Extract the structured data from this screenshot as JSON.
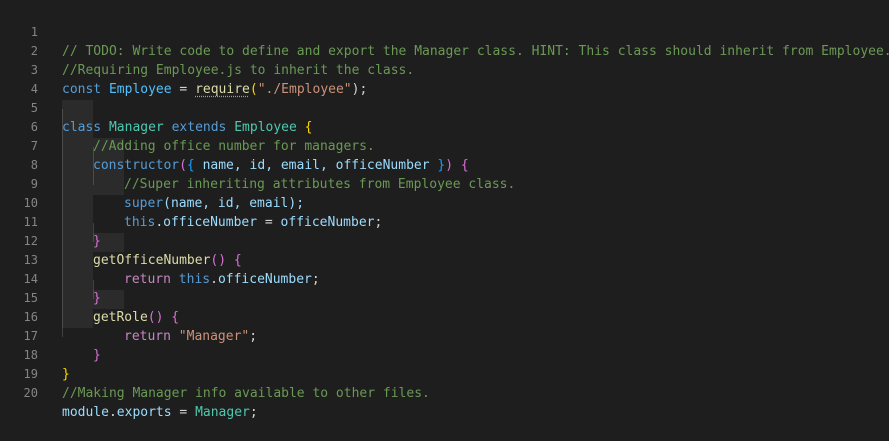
{
  "editor": {
    "line_numbers": [
      "1",
      "2",
      "3",
      "4",
      "5",
      "6",
      "7",
      "8",
      "9",
      "10",
      "11",
      "12",
      "13",
      "14",
      "15",
      "16",
      "17",
      "18",
      "19",
      "20"
    ],
    "lines": [
      {
        "comment": "// TODO: Write code to define and export the Manager class. HINT: This class should inherit from Employee."
      },
      {
        "comment": "//Requiring Employee.js to inherit the class."
      },
      {
        "kw": "const",
        "name": "Employee",
        "op": " = ",
        "fn": "require",
        "open": "(",
        "str": "\"./Employee\"",
        "close": ");"
      },
      {},
      {
        "kw": "class",
        "name": "Manager",
        "kw2": "extends",
        "base": "Employee",
        "brace": "{"
      },
      {
        "comment": "//Adding office number for managers."
      },
      {
        "fn": "constructor",
        "p1": "(",
        "b": "{",
        "params": " name, id, email, officeNumber ",
        "b2": "}",
        "p2": ")",
        "brace": "{"
      },
      {
        "comment": "//Super inheriting attributes from Employee class."
      },
      {
        "fn": "super",
        "args": "(name, id, email);"
      },
      {
        "kw": "this",
        "dot": ".",
        "prop": "officeNumber",
        "op": " = ",
        "val": "officeNumber",
        "end": ";"
      },
      {
        "brace": "}"
      },
      {
        "fn": "getOfficeNumber",
        "args": "()",
        "brace": "{"
      },
      {
        "ctrl": "return",
        "kw": "this",
        "dot": ".",
        "prop": "officeNumber",
        "end": ";"
      },
      {
        "brace": "}"
      },
      {
        "fn": "getRole",
        "args": "()",
        "brace": "{"
      },
      {
        "ctrl": "return",
        "str": "\"Manager\"",
        "end": ";"
      },
      {
        "brace": "}"
      },
      {
        "brace": "}"
      },
      {
        "comment": "//Making Manager info available to other files."
      },
      {
        "obj": "module",
        "dot": ".",
        "prop": "exports",
        "op": " = ",
        "val": "Manager",
        "end": ";"
      }
    ]
  },
  "colors": {
    "background": "#1e1e1e",
    "comment": "#6a9955",
    "keyword": "#569cd6",
    "class": "#4ec9b0",
    "variable": "#9cdcfe",
    "function": "#dcdcaa",
    "string": "#ce9178",
    "control": "#c586c0"
  }
}
